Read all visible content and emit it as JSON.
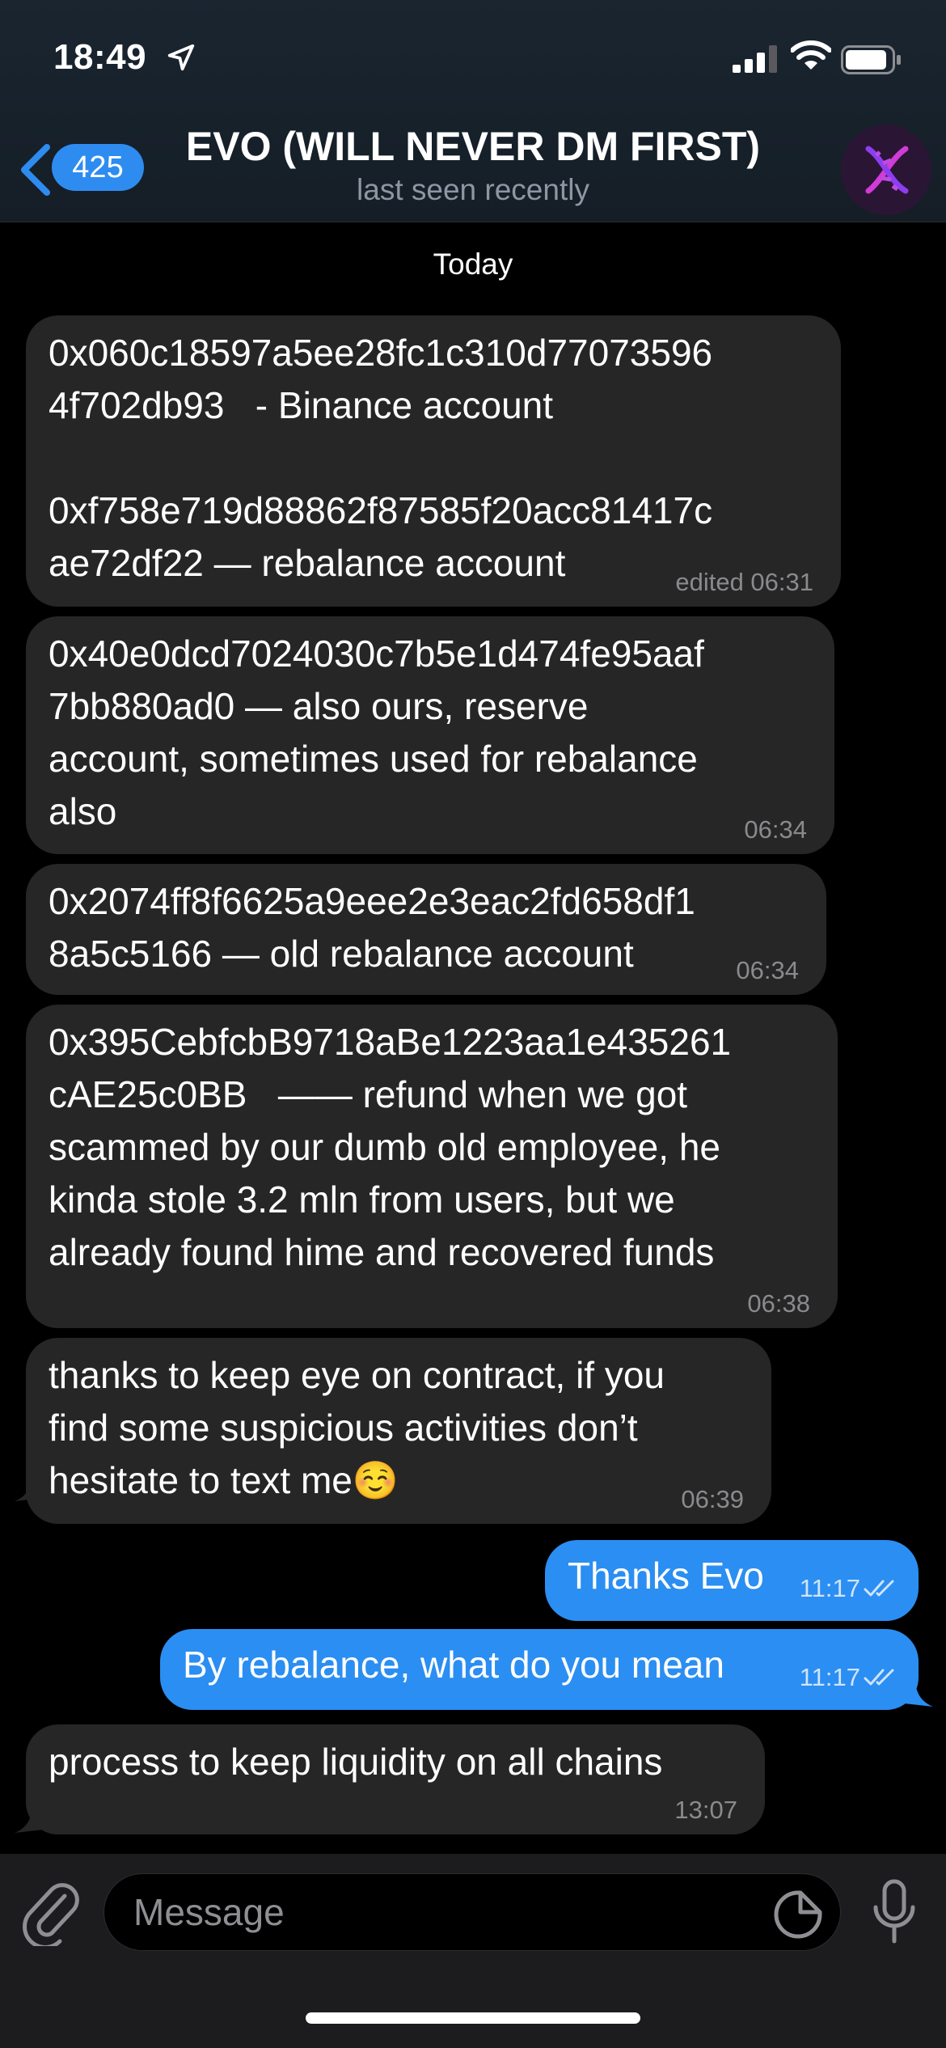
{
  "status_bar": {
    "time": "18:49"
  },
  "header": {
    "back_count": "425",
    "title": "EVO (WILL NEVER DM FIRST)",
    "subtitle": "last seen recently"
  },
  "date_label": "Today",
  "messages": [
    {
      "direction": "incoming",
      "text": "0x060c18597a5ee28fc1c310d77073596\n4f702db93   - Binance account\n\n0xf758e719d88862f87585f20acc81417c\nae72df22 — rebalance account",
      "time": "edited 06:31"
    },
    {
      "direction": "incoming",
      "text": "0x40e0dcd7024030c7b5e1d474fe95aaf\n7bb880ad0 — also ours, reserve\naccount, sometimes used for rebalance\nalso",
      "time": "06:34"
    },
    {
      "direction": "incoming",
      "text": "0x2074ff8f6625a9eee2e3eac2fd658df1\n8a5c5166 — old rebalance account",
      "time": "06:34"
    },
    {
      "direction": "incoming",
      "text": "0x395CebfcbB9718aBe1223aa1e435261\ncAE25c0BB   —— refund when we got\nscammed by our dumb old employee, he\nkinda stole 3.2 mln from users, but we\nalready found hime and recovered funds",
      "time": "06:38"
    },
    {
      "direction": "incoming",
      "text": "thanks to keep eye on contract, if you\nfind some suspicious activities don’t\nhesitate to text me☺️",
      "time": "06:39"
    },
    {
      "direction": "outgoing",
      "text": "Thanks Evo",
      "time": "11:17"
    },
    {
      "direction": "outgoing",
      "text": "By rebalance, what do you mean",
      "time": "11:17"
    },
    {
      "direction": "incoming",
      "text": "process to keep liquidity on all chains",
      "time": "13:07"
    }
  ],
  "input": {
    "placeholder": "Message"
  },
  "colors": {
    "accent": "#2b8ef2",
    "incoming_bubble": "#262626",
    "background": "#000000"
  },
  "icons": {
    "location": "location-arrow-icon",
    "signal": "cellular-signal-icon",
    "wifi": "wifi-icon",
    "battery": "battery-icon",
    "back": "chevron-left-icon",
    "avatar": "dna-helix-avatar",
    "attach": "paperclip-icon",
    "sticker": "sticker-icon",
    "mic": "microphone-icon",
    "read": "double-check-icon"
  }
}
